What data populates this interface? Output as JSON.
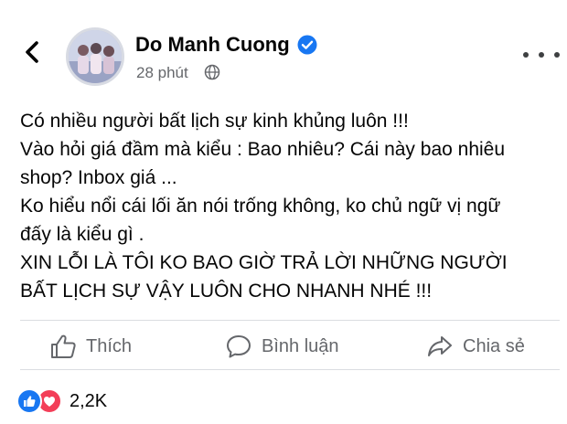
{
  "post": {
    "author": "Do Manh Cuong",
    "verified": true,
    "timestamp": "28 phút",
    "privacy_icon": "globe-icon",
    "lines": [
      "Có nhiều người bất lịch sự kinh khủng luôn !!!",
      "Vào hỏi giá đầm mà kiểu : Bao nhiêu? Cái này bao nhiêu",
      "shop? Inbox giá ...",
      "Ko hiểu nổi cái lối ăn nói trống không, ko chủ ngữ vị ngữ",
      "đấy là kiểu gì .",
      "XIN LỖI LÀ TÔI KO BAO GIỜ TRẢ LỜI NHỮNG NGƯỜI",
      "BẤT LỊCH SỰ VẬY LUÔN CHO NHANH NHÉ !!!"
    ]
  },
  "actions": {
    "like_label": "Thích",
    "comment_label": "Bình luận",
    "share_label": "Chia sẻ"
  },
  "reactions": {
    "count": "2,2K",
    "types": [
      "like",
      "love"
    ]
  },
  "colors": {
    "brand_blue": "#1877f2",
    "love_red": "#f33e58",
    "secondary_text": "#65676b"
  }
}
